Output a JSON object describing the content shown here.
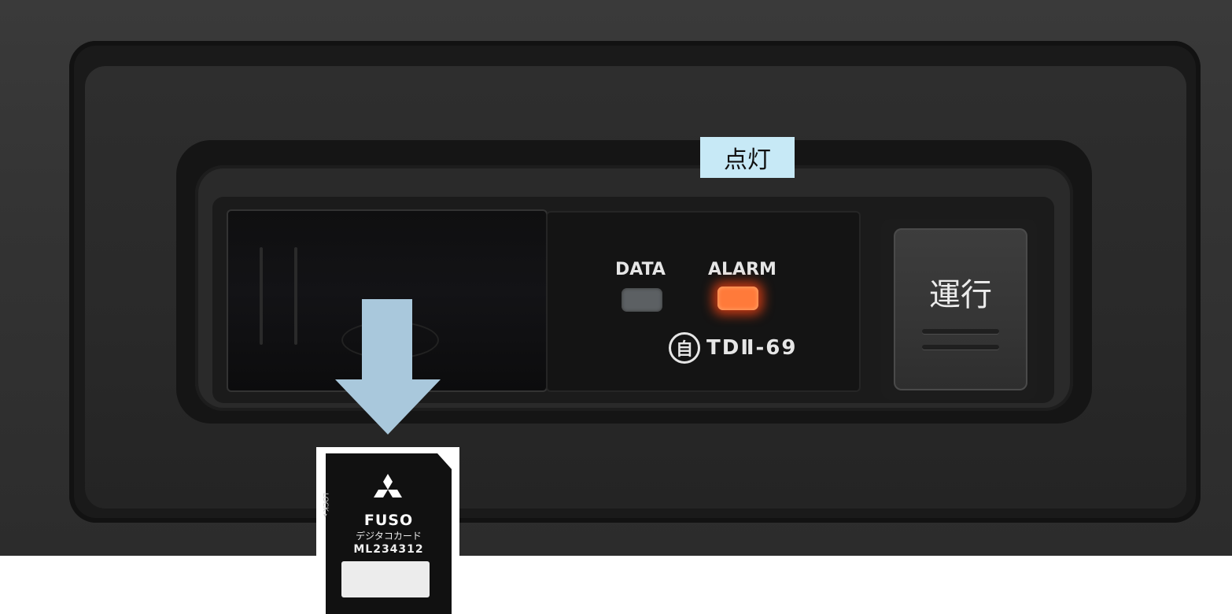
{
  "callout": {
    "label": "点灯"
  },
  "indicators": {
    "data_label": "DATA",
    "alarm_label": "ALARM",
    "alarm_color": "#ff7a3a",
    "data_color": "#5c6063"
  },
  "model": {
    "symbol": "自",
    "name": "TDⅡ-69"
  },
  "run_button": {
    "label": "運行"
  },
  "arrow": {
    "color": "#a9c8dc",
    "icon": "down-arrow-icon"
  },
  "sd_card": {
    "lock": "LOCK ▸",
    "brand": "FUSO",
    "subtitle": "デジタコカード",
    "part_number": "ML234312",
    "logo": "three-diamond-icon"
  }
}
